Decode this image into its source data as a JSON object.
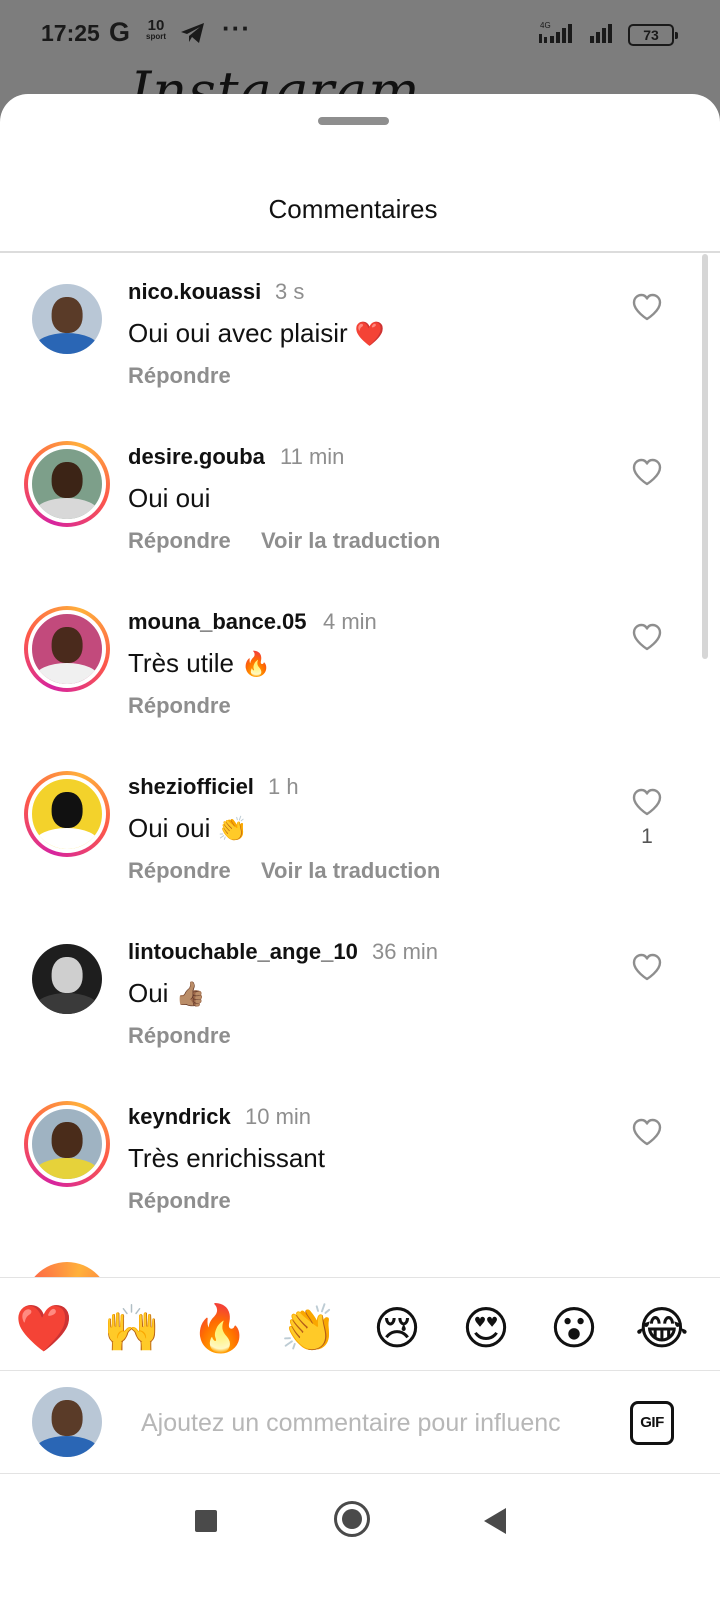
{
  "status_bar": {
    "time": "17:25",
    "g_label": "G",
    "sport_number": "10",
    "sport_label": "sport",
    "overflow": "···",
    "network": "4G",
    "battery": "73"
  },
  "background_app": {
    "logo_fragment": "Instagram"
  },
  "sheet": {
    "title": "Commentaires"
  },
  "comments": [
    {
      "username": "nico.kouassi",
      "time": "3 s",
      "text": "Oui oui avec plaisir",
      "emoji": "❤️",
      "reply_label": "Répondre",
      "translate_label": "",
      "likes": "",
      "ring": false,
      "avatar": {
        "bg": "#b9c7d6",
        "face": "#5a3b28",
        "body": "#2a66b5"
      }
    },
    {
      "username": "desire.gouba",
      "time": "11 min",
      "text": "Oui oui",
      "emoji": "",
      "reply_label": "Répondre",
      "translate_label": "Voir la traduction",
      "likes": "",
      "ring": true,
      "avatar": {
        "bg": "#7d9f8a",
        "face": "#3c2416",
        "body": "#d8d8d8"
      }
    },
    {
      "username": "mouna_bance.05",
      "time": "4 min",
      "text": "Très utile",
      "emoji": "🔥",
      "reply_label": "Répondre",
      "translate_label": "",
      "likes": "",
      "ring": true,
      "avatar": {
        "bg": "#c24a7c",
        "face": "#4a2a1c",
        "body": "#f0f0f0"
      }
    },
    {
      "username": "sheziofficiel",
      "time": "1 h",
      "text": "Oui oui",
      "emoji": "👏",
      "reply_label": "Répondre",
      "translate_label": "Voir la traduction",
      "likes": "1",
      "ring": true,
      "avatar": {
        "bg": "#f3d22b",
        "face": "#111111",
        "body": "#ffffff"
      }
    },
    {
      "username": "lintouchable_ange_10",
      "time": "36 min",
      "text": "Oui",
      "emoji": "👍🏽",
      "reply_label": "Répondre",
      "translate_label": "",
      "likes": "",
      "ring": false,
      "avatar": {
        "bg": "#1e1e1e",
        "face": "#cfcfcf",
        "body": "#3a3a3a"
      }
    },
    {
      "username": "keyndrick",
      "time": "10 min",
      "text": "Très enrichissant",
      "emoji": "",
      "reply_label": "Répondre",
      "translate_label": "",
      "likes": "",
      "ring": true,
      "avatar": {
        "bg": "#9fb3c2",
        "face": "#4a2c1a",
        "body": "#e6d23a"
      }
    }
  ],
  "reactions": [
    {
      "emoji": "❤️",
      "has_options": false
    },
    {
      "emoji": "🙌",
      "has_options": true
    },
    {
      "emoji": "🔥",
      "has_options": false
    },
    {
      "emoji": "👏",
      "has_options": true
    },
    {
      "emoji": "😢",
      "has_options": false
    },
    {
      "emoji": "😍",
      "has_options": false
    },
    {
      "emoji": "😮",
      "has_options": false
    },
    {
      "emoji": "😂",
      "has_options": false
    }
  ],
  "composer": {
    "placeholder": "Ajoutez un commentaire pour influenc",
    "value": "",
    "gif_label": "GIF",
    "avatar": {
      "bg": "#b9c7d6",
      "face": "#5a3b28",
      "body": "#2a66b5"
    }
  },
  "colors": {
    "ring_start": "#d6249f",
    "ring_end": "#ffb13b",
    "secondary_text": "#8e8e8e",
    "heart_red": "#e0245e"
  }
}
